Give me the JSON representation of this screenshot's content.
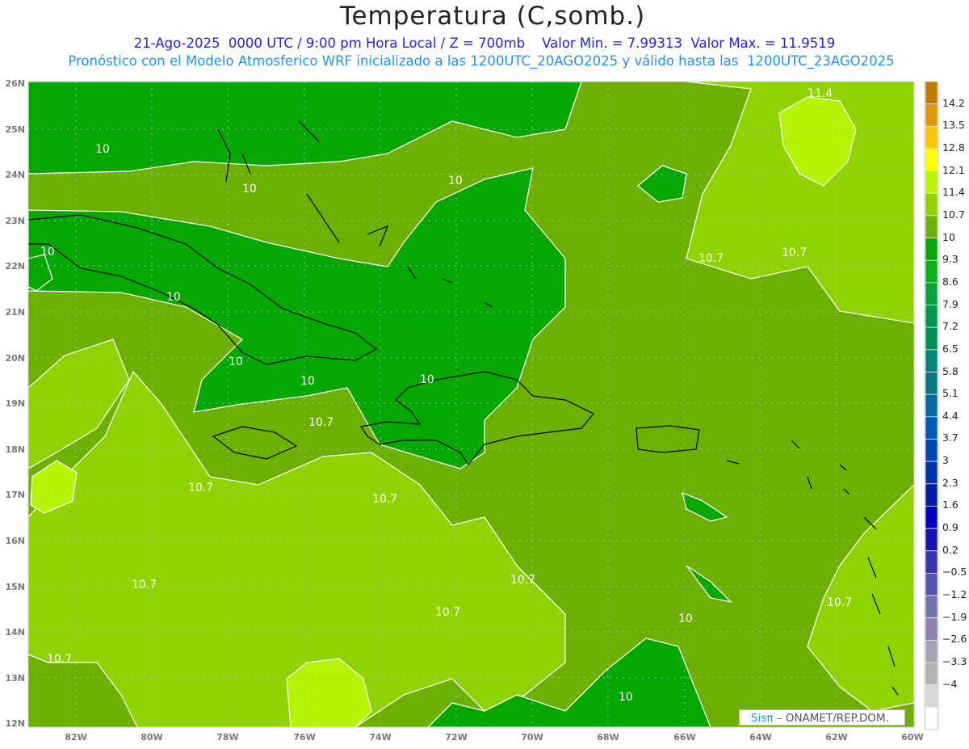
{
  "header": {
    "title": "Temperatura (C,somb.)",
    "subtitle": "21-Ago-2025  0000 UTC / 9:00 pm Hora Local / Z = 700mb    Valor Min. = 7.99313  Valor Max. = 11.9519",
    "forecast_info": "Pronóstico con el Modelo Atmosferico WRF inicializado a las 1200UTC_20AGO2025 y válido hasta las  1200UTC_23AGO2025"
  },
  "axes": {
    "lon_labels": [
      "82W",
      "80W",
      "78W",
      "76W",
      "74W",
      "72W",
      "70W",
      "68W",
      "66W",
      "64W",
      "62W",
      "60W"
    ],
    "lat_labels": [
      "12N",
      "13N",
      "14N",
      "15N",
      "16N",
      "17N",
      "18N",
      "19N",
      "20N",
      "21N",
      "22N",
      "23N",
      "24N",
      "25N",
      "26N"
    ]
  },
  "map": {
    "contour_labels": [
      "10",
      "10",
      "10",
      "10",
      "10",
      "10",
      "10",
      "10",
      "10",
      "10",
      "10.7",
      "10.7",
      "10.7",
      "10.7",
      "10.7",
      "10.7",
      "10.7",
      "10.7",
      "10.7",
      "10.7",
      "11.4"
    ],
    "fill_colors": {
      "dark": "#05a800",
      "base": "#6cb000",
      "light": "#8fd400",
      "bright": "#b5f500"
    }
  },
  "colorbar": {
    "labels": [
      "14.2",
      "13.5",
      "12.8",
      "12.1",
      "11.4",
      "10.7",
      "10",
      "9.3",
      "8.6",
      "7.9",
      "7.2",
      "6.5",
      "5.8",
      "5.1",
      "4.4",
      "3.7",
      "3",
      "2.3",
      "1.6",
      "0.9",
      "0.2",
      "−0.5",
      "−1.2",
      "−1.9",
      "−2.6",
      "−3.3",
      "−4"
    ],
    "colors": [
      "#c07c00",
      "#e09800",
      "#ffc400",
      "#ffff00",
      "#b6f500",
      "#8fd400",
      "#6cb000",
      "#05a800",
      "#00b41a",
      "#00a63c",
      "#00984c",
      "#008f55",
      "#00857a",
      "#007a82",
      "#006ca4",
      "#0058b8",
      "#0046b0",
      "#0032a8",
      "#001ca8",
      "#0000c4",
      "#1414b0",
      "#3434ac",
      "#5555ae",
      "#7272b0",
      "#9080b0",
      "#a4a4b0",
      "#b2b2b2",
      "#d6d6d6",
      "#ffffff"
    ]
  },
  "credits": {
    "logo": "Sisπ",
    "text": " –  ONAMET/REP.DOM."
  }
}
